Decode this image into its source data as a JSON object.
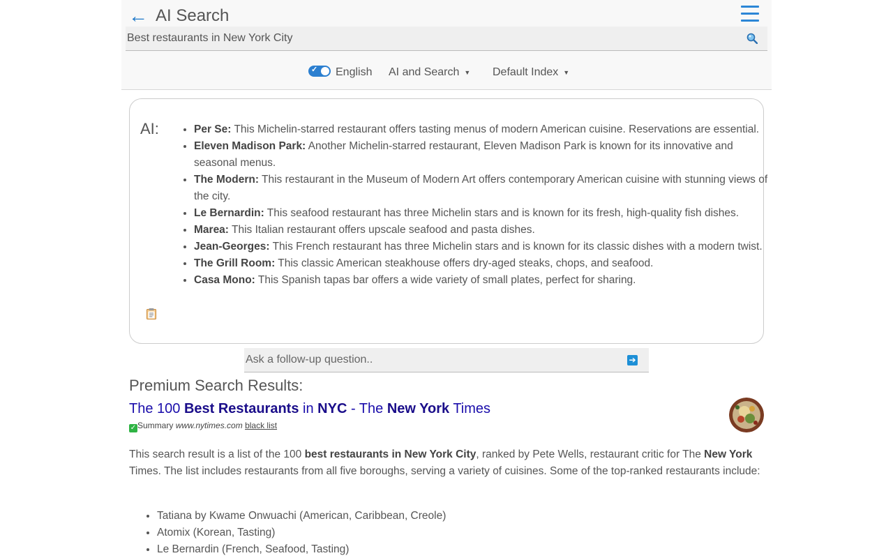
{
  "header": {
    "title": "AI Search",
    "back_icon": "back-arrow-icon",
    "menu_icon": "hamburger-menu-icon"
  },
  "search": {
    "value": "Best restaurants in New York City",
    "icon": "magnifier-icon"
  },
  "options": {
    "language_toggle_on": true,
    "language": "English",
    "mode": "AI and Search",
    "index": "Default Index"
  },
  "ai": {
    "label": "AI:",
    "items": [
      {
        "name": "Per Se:",
        "desc": " This Michelin-starred restaurant offers tasting menus of modern American cuisine. Reservations are essential."
      },
      {
        "name": "Eleven Madison Park:",
        "desc": " Another Michelin-starred restaurant, Eleven Madison Park is known for its innovative and seasonal menus."
      },
      {
        "name": "The Modern:",
        "desc": " This restaurant in the Museum of Modern Art offers contemporary American cuisine with stunning views of the city."
      },
      {
        "name": "Le Bernardin:",
        "desc": " This seafood restaurant has three Michelin stars and is known for its fresh, high-quality fish dishes."
      },
      {
        "name": "Marea:",
        "desc": " This Italian restaurant offers upscale seafood and pasta dishes."
      },
      {
        "name": "Jean-Georges:",
        "desc": " This French restaurant has three Michelin stars and is known for its classic dishes with a modern twist."
      },
      {
        "name": "The Grill Room:",
        "desc": " This classic American steakhouse offers dry-aged steaks, chops, and seafood."
      },
      {
        "name": "Casa Mono:",
        "desc": " This Spanish tapas bar offers a wide variety of small plates, perfect for sharing."
      }
    ]
  },
  "followup": {
    "placeholder": "Ask a follow-up question.."
  },
  "results": {
    "heading": "Premium Search Results:",
    "items": [
      {
        "title_parts": [
          {
            "text": "The 100 ",
            "bold": false
          },
          {
            "text": "Best Restaurants",
            "bold": true
          },
          {
            "text": " in ",
            "bold": false
          },
          {
            "text": "NYC",
            "bold": true
          },
          {
            "text": " - The ",
            "bold": false
          },
          {
            "text": "New York",
            "bold": true
          },
          {
            "text": " Times",
            "bold": false
          }
        ],
        "summary_label": "Summary",
        "domain": "www.nytimes.com",
        "blacklist_label": "black list",
        "summary_parts": [
          {
            "text": "This search result is a list of the 100 ",
            "bold": false
          },
          {
            "text": "best restaurants in New York City",
            "bold": true
          },
          {
            "text": ", ranked by Pete Wells, restaurant critic for The ",
            "bold": false
          },
          {
            "text": "New York",
            "bold": true
          },
          {
            "text": " Times. The list includes restaurants from all five boroughs, serving a variety of cuisines. Some of the top-ranked restaurants include:",
            "bold": false
          }
        ],
        "list": [
          "Tatiana by Kwame Onwuachi (American, Caribbean, Creole)",
          "Atomix (Korean, Tasting)",
          "Le Bernardin (French, Seafood, Tasting)"
        ]
      }
    ]
  },
  "colors": {
    "accent": "#1d78c9",
    "link": "#1a0dab",
    "check": "#2fb344"
  }
}
